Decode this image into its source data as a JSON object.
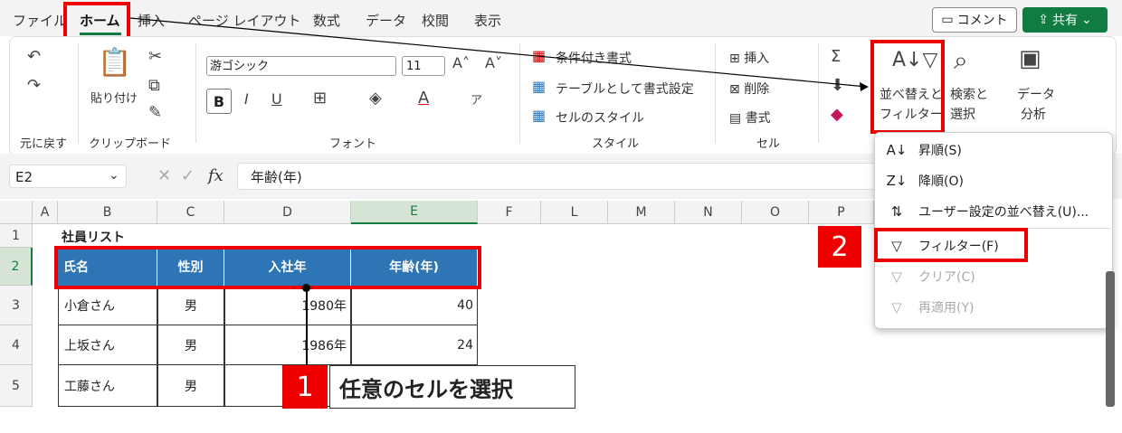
{
  "tabs": [
    "ファイル",
    "ホーム",
    "挿入",
    "ページ レイアウト",
    "数式",
    "データ",
    "校閲",
    "表示"
  ],
  "header_buttons": {
    "comment": "コメント",
    "share": "共有"
  },
  "ribbon": {
    "undo_group": "元に戻す",
    "clipboard_group": "クリップボード",
    "paste": "貼り付け",
    "font_group": "フォント",
    "font_name": "游ゴシック",
    "font_size": "11",
    "bold": "B",
    "italic": "I",
    "underline": "U",
    "style_group": "スタイル",
    "conditional": "条件付き書式",
    "table_format": "テーブルとして書式設定",
    "cell_style": "セルのスタイル",
    "cells_group": "セル",
    "insert": "挿入",
    "delete": "削除",
    "format": "書式",
    "sort_filter_1": "並べ替えと",
    "sort_filter_2": "フィルター",
    "find_1": "検索と",
    "find_2": "選択",
    "analyze_1": "データ",
    "analyze_2": "分析"
  },
  "formula_bar": {
    "name_box": "E2",
    "content": "年齢(年)",
    "fx": "fx"
  },
  "columns": [
    "A",
    "B",
    "C",
    "D",
    "E",
    "F",
    "L",
    "M",
    "N",
    "O",
    "P"
  ],
  "rows": [
    "1",
    "2",
    "3",
    "4",
    "5"
  ],
  "sheet": {
    "title": "社員リスト",
    "headers": [
      "氏名",
      "性別",
      "入社年",
      "年齢(年)"
    ],
    "data": [
      [
        "小倉さん",
        "男",
        "1980年",
        "40"
      ],
      [
        "上坂さん",
        "男",
        "1986年",
        "24"
      ],
      [
        "工藤さん",
        "男",
        "",
        ""
      ]
    ]
  },
  "menu": [
    {
      "label": "昇順(S)",
      "icon": "sort-asc-icon",
      "disabled": false
    },
    {
      "label": "降順(O)",
      "icon": "sort-desc-icon",
      "disabled": false
    },
    {
      "label": "ユーザー設定の並べ替え(U)...",
      "icon": "custom-sort-icon",
      "disabled": false
    },
    {
      "label": "フィルター(F)",
      "icon": "filter-icon",
      "disabled": false
    },
    {
      "label": "クリア(C)",
      "icon": "clear-filter-icon",
      "disabled": true
    },
    {
      "label": "再適用(Y)",
      "icon": "reapply-icon",
      "disabled": true
    }
  ],
  "annotations": {
    "step1_num": "1",
    "step1_text": "任意のセルを選択",
    "step2_num": "2"
  },
  "colors": {
    "accent": "#107c41",
    "header_fill": "#2e75b6",
    "highlight": "#e00000"
  }
}
